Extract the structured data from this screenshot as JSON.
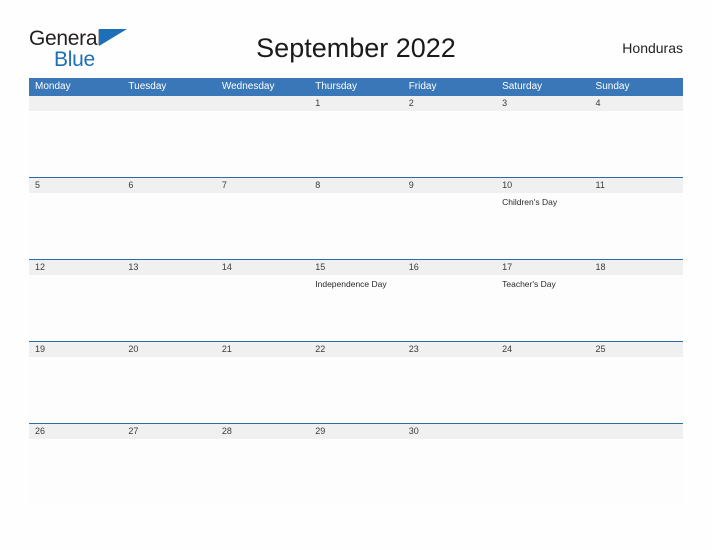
{
  "brand": {
    "word1": "General",
    "word2": "Blue",
    "triangle_color": "#1d70b7",
    "text_color": "#231f20"
  },
  "header": {
    "title": "September 2022",
    "locale": "Honduras"
  },
  "colors": {
    "header_blue": "#3a77b8",
    "separator_blue": "#2b6ca3",
    "date_band_gray": "#f0f0f0",
    "page_background": "#fefefe"
  },
  "calendar": {
    "weekday_headers": [
      "Monday",
      "Tuesday",
      "Wednesday",
      "Thursday",
      "Friday",
      "Saturday",
      "Sunday"
    ],
    "weeks": [
      {
        "dates": [
          "",
          "",
          "",
          "1",
          "2",
          "3",
          "4"
        ],
        "events": [
          [],
          [],
          [],
          [],
          [],
          [],
          []
        ]
      },
      {
        "dates": [
          "5",
          "6",
          "7",
          "8",
          "9",
          "10",
          "11"
        ],
        "events": [
          [],
          [],
          [],
          [],
          [],
          [
            "Children's Day"
          ],
          []
        ]
      },
      {
        "dates": [
          "12",
          "13",
          "14",
          "15",
          "16",
          "17",
          "18"
        ],
        "events": [
          [],
          [],
          [],
          [
            "Independence Day"
          ],
          [],
          [
            "Teacher's Day"
          ],
          []
        ]
      },
      {
        "dates": [
          "19",
          "20",
          "21",
          "22",
          "23",
          "24",
          "25"
        ],
        "events": [
          [],
          [],
          [],
          [],
          [],
          [],
          []
        ]
      },
      {
        "dates": [
          "26",
          "27",
          "28",
          "29",
          "30",
          "",
          ""
        ],
        "events": [
          [],
          [],
          [],
          [],
          [],
          [],
          []
        ]
      }
    ]
  }
}
